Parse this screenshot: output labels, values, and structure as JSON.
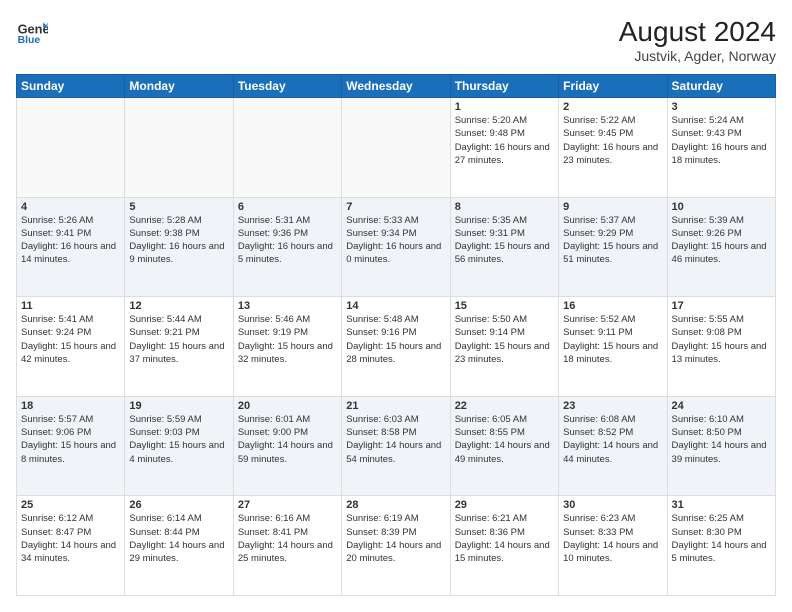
{
  "header": {
    "logo_line1": "General",
    "logo_line2": "Blue",
    "title": "August 2024",
    "subtitle": "Justvik, Agder, Norway"
  },
  "weekdays": [
    "Sunday",
    "Monday",
    "Tuesday",
    "Wednesday",
    "Thursday",
    "Friday",
    "Saturday"
  ],
  "weeks": [
    [
      {
        "day": "",
        "sunrise": "",
        "sunset": "",
        "daylight": ""
      },
      {
        "day": "",
        "sunrise": "",
        "sunset": "",
        "daylight": ""
      },
      {
        "day": "",
        "sunrise": "",
        "sunset": "",
        "daylight": ""
      },
      {
        "day": "",
        "sunrise": "",
        "sunset": "",
        "daylight": ""
      },
      {
        "day": "1",
        "sunrise": "5:20 AM",
        "sunset": "9:48 PM",
        "daylight": "16 hours and 27 minutes."
      },
      {
        "day": "2",
        "sunrise": "5:22 AM",
        "sunset": "9:45 PM",
        "daylight": "16 hours and 23 minutes."
      },
      {
        "day": "3",
        "sunrise": "5:24 AM",
        "sunset": "9:43 PM",
        "daylight": "16 hours and 18 minutes."
      }
    ],
    [
      {
        "day": "4",
        "sunrise": "5:26 AM",
        "sunset": "9:41 PM",
        "daylight": "16 hours and 14 minutes."
      },
      {
        "day": "5",
        "sunrise": "5:28 AM",
        "sunset": "9:38 PM",
        "daylight": "16 hours and 9 minutes."
      },
      {
        "day": "6",
        "sunrise": "5:31 AM",
        "sunset": "9:36 PM",
        "daylight": "16 hours and 5 minutes."
      },
      {
        "day": "7",
        "sunrise": "5:33 AM",
        "sunset": "9:34 PM",
        "daylight": "16 hours and 0 minutes."
      },
      {
        "day": "8",
        "sunrise": "5:35 AM",
        "sunset": "9:31 PM",
        "daylight": "15 hours and 56 minutes."
      },
      {
        "day": "9",
        "sunrise": "5:37 AM",
        "sunset": "9:29 PM",
        "daylight": "15 hours and 51 minutes."
      },
      {
        "day": "10",
        "sunrise": "5:39 AM",
        "sunset": "9:26 PM",
        "daylight": "15 hours and 46 minutes."
      }
    ],
    [
      {
        "day": "11",
        "sunrise": "5:41 AM",
        "sunset": "9:24 PM",
        "daylight": "15 hours and 42 minutes."
      },
      {
        "day": "12",
        "sunrise": "5:44 AM",
        "sunset": "9:21 PM",
        "daylight": "15 hours and 37 minutes."
      },
      {
        "day": "13",
        "sunrise": "5:46 AM",
        "sunset": "9:19 PM",
        "daylight": "15 hours and 32 minutes."
      },
      {
        "day": "14",
        "sunrise": "5:48 AM",
        "sunset": "9:16 PM",
        "daylight": "15 hours and 28 minutes."
      },
      {
        "day": "15",
        "sunrise": "5:50 AM",
        "sunset": "9:14 PM",
        "daylight": "15 hours and 23 minutes."
      },
      {
        "day": "16",
        "sunrise": "5:52 AM",
        "sunset": "9:11 PM",
        "daylight": "15 hours and 18 minutes."
      },
      {
        "day": "17",
        "sunrise": "5:55 AM",
        "sunset": "9:08 PM",
        "daylight": "15 hours and 13 minutes."
      }
    ],
    [
      {
        "day": "18",
        "sunrise": "5:57 AM",
        "sunset": "9:06 PM",
        "daylight": "15 hours and 8 minutes."
      },
      {
        "day": "19",
        "sunrise": "5:59 AM",
        "sunset": "9:03 PM",
        "daylight": "15 hours and 4 minutes."
      },
      {
        "day": "20",
        "sunrise": "6:01 AM",
        "sunset": "9:00 PM",
        "daylight": "14 hours and 59 minutes."
      },
      {
        "day": "21",
        "sunrise": "6:03 AM",
        "sunset": "8:58 PM",
        "daylight": "14 hours and 54 minutes."
      },
      {
        "day": "22",
        "sunrise": "6:05 AM",
        "sunset": "8:55 PM",
        "daylight": "14 hours and 49 minutes."
      },
      {
        "day": "23",
        "sunrise": "6:08 AM",
        "sunset": "8:52 PM",
        "daylight": "14 hours and 44 minutes."
      },
      {
        "day": "24",
        "sunrise": "6:10 AM",
        "sunset": "8:50 PM",
        "daylight": "14 hours and 39 minutes."
      }
    ],
    [
      {
        "day": "25",
        "sunrise": "6:12 AM",
        "sunset": "8:47 PM",
        "daylight": "14 hours and 34 minutes."
      },
      {
        "day": "26",
        "sunrise": "6:14 AM",
        "sunset": "8:44 PM",
        "daylight": "14 hours and 29 minutes."
      },
      {
        "day": "27",
        "sunrise": "6:16 AM",
        "sunset": "8:41 PM",
        "daylight": "14 hours and 25 minutes."
      },
      {
        "day": "28",
        "sunrise": "6:19 AM",
        "sunset": "8:39 PM",
        "daylight": "14 hours and 20 minutes."
      },
      {
        "day": "29",
        "sunrise": "6:21 AM",
        "sunset": "8:36 PM",
        "daylight": "14 hours and 15 minutes."
      },
      {
        "day": "30",
        "sunrise": "6:23 AM",
        "sunset": "8:33 PM",
        "daylight": "14 hours and 10 minutes."
      },
      {
        "day": "31",
        "sunrise": "6:25 AM",
        "sunset": "8:30 PM",
        "daylight": "14 hours and 5 minutes."
      }
    ]
  ]
}
